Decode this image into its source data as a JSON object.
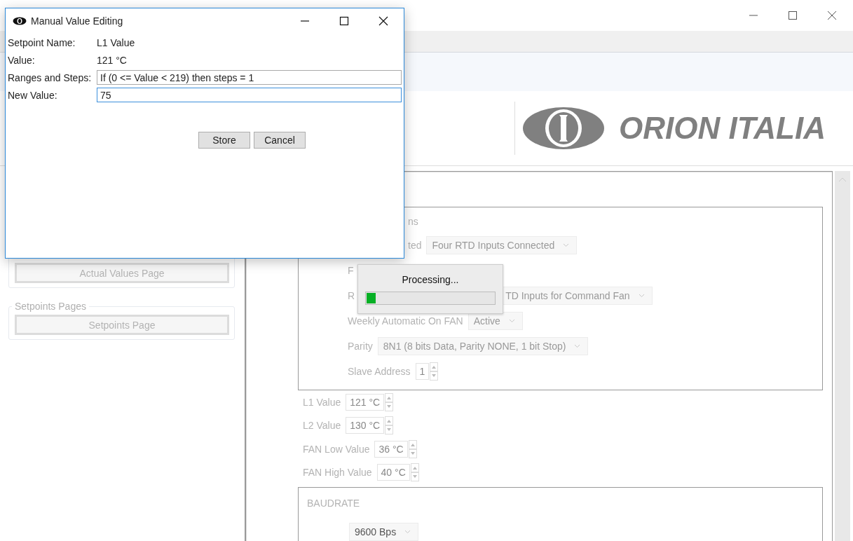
{
  "main_window": {
    "logo_text": "ORION ITALIA"
  },
  "sidebar": {
    "groups": [
      {
        "button": "Actual Values Page"
      },
      {
        "legend": "Setpoints Pages",
        "button": "Setpoints Page"
      }
    ]
  },
  "settings": {
    "group_title": "ns",
    "rows": [
      {
        "kind": "dropdown",
        "label": "ted",
        "value": "Four RTD Inputs Connected"
      },
      {
        "kind": "blank",
        "label": "F"
      },
      {
        "kind": "dropdown",
        "label": "R",
        "value": "TD Inputs for Command Fan"
      },
      {
        "kind": "dropdown",
        "label": "Weekly Automatic On FAN",
        "value": "Active"
      },
      {
        "kind": "dropdown",
        "label": "Parity",
        "value": "8N1 (8 bits Data, Parity NONE, 1 bit Stop)"
      },
      {
        "kind": "spinner",
        "label": "Slave Address",
        "value": "1"
      }
    ]
  },
  "setpoints": [
    {
      "label": "L1 Value",
      "value": "121 °C"
    },
    {
      "label": "L2 Value",
      "value": "130 °C"
    },
    {
      "label": "FAN Low Value",
      "value": "36 °C"
    },
    {
      "label": "FAN High Value",
      "value": "40 °C"
    }
  ],
  "baudrate": {
    "title": "BAUDRATE",
    "value": "9600 Bps"
  },
  "dialog": {
    "title": "Manual Value Editing",
    "rows": [
      {
        "kind": "text",
        "label": "Setpoint Name:",
        "value": "L1 Value"
      },
      {
        "kind": "text",
        "label": "Value:",
        "value": "121 °C"
      },
      {
        "kind": "field",
        "label": "Ranges and Steps:",
        "value": "If (0 <= Value < 219) then steps = 1",
        "focused": false
      },
      {
        "kind": "field",
        "label": "New Value:",
        "value": "75",
        "focused": true
      }
    ],
    "buttons": [
      "Store",
      "Cancel"
    ]
  },
  "processing": {
    "text": "Processing...",
    "level": 0.07
  }
}
